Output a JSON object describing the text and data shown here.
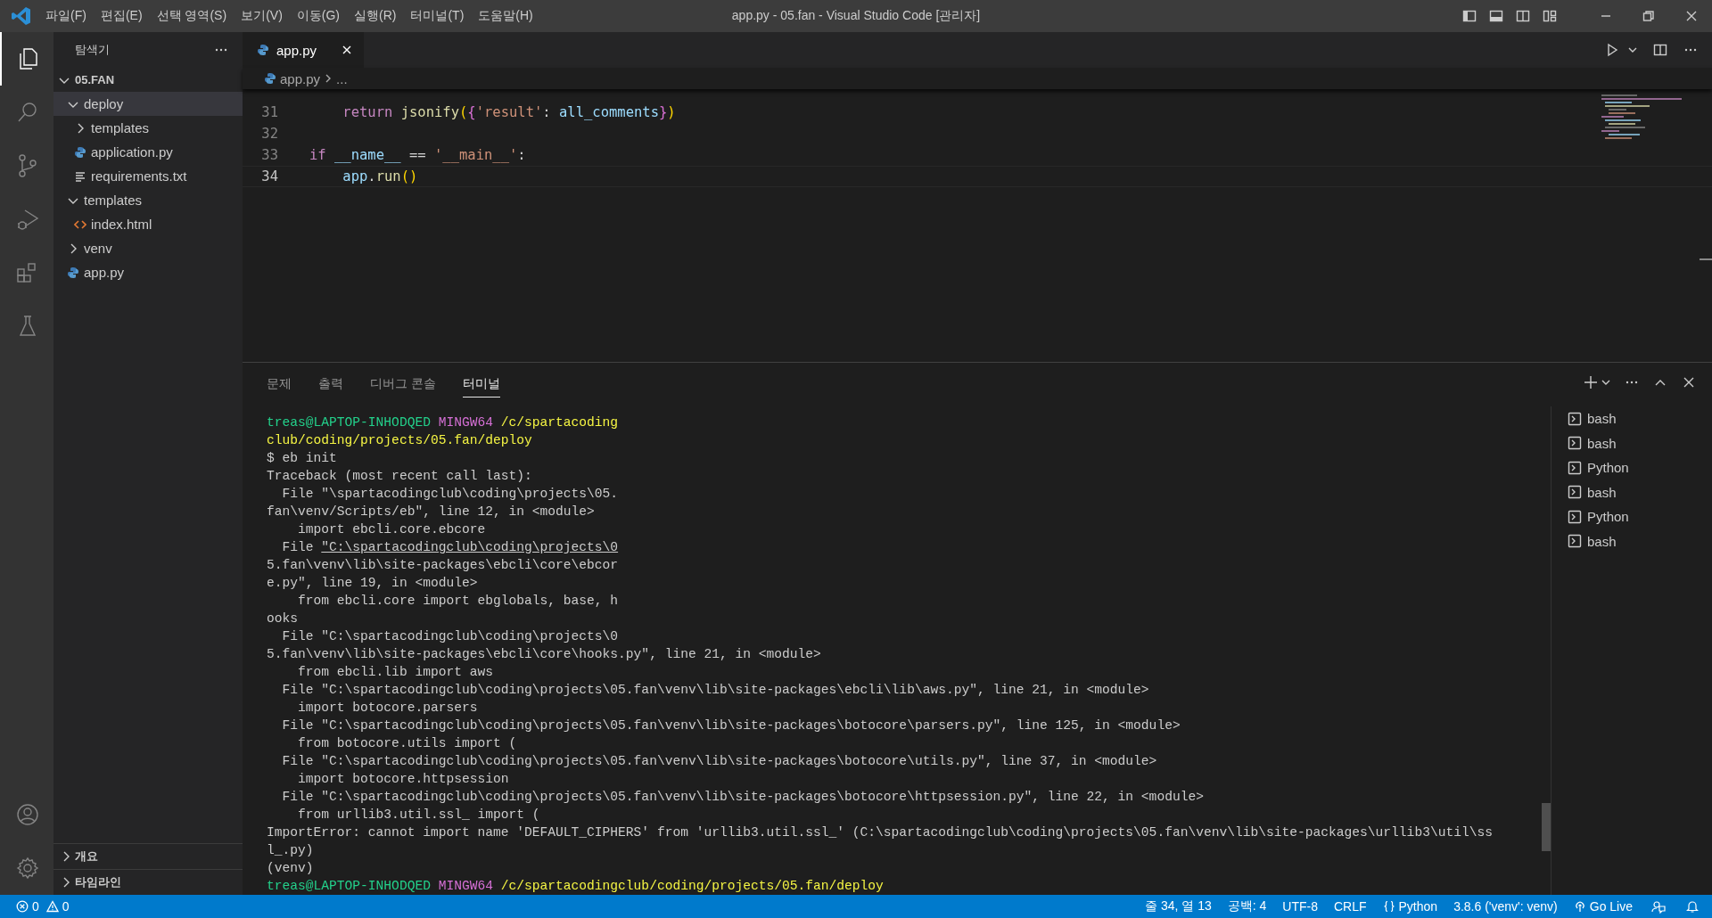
{
  "window": {
    "title": "app.py - 05.fan - Visual Studio Code [관리자]"
  },
  "menu": [
    "파일(F)",
    "편집(E)",
    "선택 영역(S)",
    "보기(V)",
    "이동(G)",
    "실행(R)",
    "터미널(T)",
    "도움말(H)"
  ],
  "activity_bar": [
    {
      "kind": "explorer",
      "selected": true
    },
    {
      "kind": "search",
      "selected": false
    },
    {
      "kind": "source-control",
      "selected": false
    },
    {
      "kind": "run-debug",
      "selected": false
    },
    {
      "kind": "extensions",
      "selected": false
    },
    {
      "kind": "testing",
      "selected": false
    }
  ],
  "activity_bar_bottom": [
    {
      "kind": "account"
    },
    {
      "kind": "settings"
    }
  ],
  "sidebar": {
    "title": "탐색기",
    "root": {
      "label": "05.FAN",
      "expanded": true
    },
    "tree": [
      {
        "label": "deploy",
        "kind": "folder",
        "expanded": true,
        "selected": true,
        "children": [
          {
            "label": "templates",
            "kind": "folder",
            "expanded": false,
            "selected": false
          },
          {
            "label": "application.py",
            "kind": "python",
            "selected": false
          },
          {
            "label": "requirements.txt",
            "kind": "text",
            "selected": false
          }
        ]
      },
      {
        "label": "templates",
        "kind": "folder",
        "expanded": true,
        "selected": false,
        "children": [
          {
            "label": "index.html",
            "kind": "html",
            "selected": false
          }
        ]
      },
      {
        "label": "venv",
        "kind": "folder",
        "expanded": false,
        "selected": false
      },
      {
        "label": "app.py",
        "kind": "python",
        "selected": false
      }
    ],
    "sections": [
      {
        "label": "개요",
        "expanded": false
      },
      {
        "label": "타임라인",
        "expanded": false
      }
    ]
  },
  "editor": {
    "tabs": [
      {
        "label": "app.py",
        "selected": true
      }
    ],
    "breadcrumb": [
      "app.py",
      "..."
    ],
    "lines": [
      {
        "number": "31",
        "current": false,
        "tokens": [
          {
            "text": "    return",
            "kind": "keyword"
          },
          {
            "text": " jsonify",
            "kind": "func"
          },
          {
            "text": "(",
            "kind": "bracket1"
          },
          {
            "text": "{",
            "kind": "bracket2"
          },
          {
            "text": "'result'",
            "kind": "string"
          },
          {
            "text": ": ",
            "kind": "plain"
          },
          {
            "text": "all_comments",
            "kind": "var"
          },
          {
            "text": "}",
            "kind": "bracket2"
          },
          {
            "text": ")",
            "kind": "bracket1"
          }
        ]
      },
      {
        "number": "32",
        "current": false
      },
      {
        "number": "33",
        "current": false,
        "tokens": [
          {
            "text": "if",
            "kind": "keyword"
          },
          {
            "text": " __name__",
            "kind": "var"
          },
          {
            "text": " == ",
            "kind": "plain"
          },
          {
            "text": "'__main__'",
            "kind": "string"
          },
          {
            "text": ":",
            "kind": "plain"
          }
        ]
      },
      {
        "number": "34",
        "current": true,
        "tokens": [
          {
            "text": "    app",
            "kind": "var"
          },
          {
            "text": ".",
            "kind": "plain"
          },
          {
            "text": "run",
            "kind": "func"
          },
          {
            "text": "()",
            "kind": "bracket1"
          }
        ]
      }
    ]
  },
  "panel": {
    "tabs": [
      {
        "label": "문제",
        "selected": false
      },
      {
        "label": "출력",
        "selected": false
      },
      {
        "label": "디버그 콘솔",
        "selected": false
      },
      {
        "label": "터미널",
        "selected": true
      }
    ],
    "terminal_lines": [
      [
        {
          "text": "treas@LAPTOP-INHODQED ",
          "kind": "user"
        },
        {
          "text": "MINGW64 ",
          "kind": "shell"
        },
        {
          "text": "/c/spartacoding",
          "kind": "path"
        }
      ],
      [
        {
          "text": "club/coding/projects/05.fan/deploy",
          "kind": "path"
        }
      ],
      [
        {
          "text": "$ eb init",
          "kind": "plain"
        }
      ],
      [
        {
          "text": "Traceback (most recent call last):",
          "kind": "plain"
        }
      ],
      [
        {
          "text": "  File \"\\spartacodingclub\\coding\\projects\\05.",
          "kind": "plain"
        }
      ],
      [
        {
          "text": "fan\\venv/Scripts/eb\", line 12, in <module>",
          "kind": "plain"
        }
      ],
      [
        {
          "text": "    import ebcli.core.ebcore",
          "kind": "plain"
        }
      ],
      [
        {
          "text": "  File ",
          "kind": "plain"
        },
        {
          "text": "\"C:\\spartacodingclub\\coding\\projects\\0",
          "kind": "link"
        }
      ],
      [
        {
          "text": "5.fan\\venv\\lib\\site-packages\\ebcli\\core\\ebcor",
          "kind": "plain"
        }
      ],
      [
        {
          "text": "e.py\", line 19, in <module>",
          "kind": "plain"
        }
      ],
      [
        {
          "text": "    from ebcli.core import ebglobals, base, h",
          "kind": "plain"
        }
      ],
      [
        {
          "text": "ooks",
          "kind": "plain"
        }
      ],
      [
        {
          "text": "  File \"C:\\spartacodingclub\\coding\\projects\\0",
          "kind": "plain"
        }
      ],
      [
        {
          "text": "5.fan\\venv\\lib\\site-packages\\ebcli\\core\\hooks.py\", line 21, in <module>",
          "kind": "plain"
        }
      ],
      [
        {
          "text": "    from ebcli.lib import aws",
          "kind": "plain"
        }
      ],
      [
        {
          "text": "  File \"C:\\spartacodingclub\\coding\\projects\\05.fan\\venv\\lib\\site-packages\\ebcli\\lib\\aws.py\", line 21, in <module>",
          "kind": "plain"
        }
      ],
      [
        {
          "text": "    import botocore.parsers",
          "kind": "plain"
        }
      ],
      [
        {
          "text": "  File \"C:\\spartacodingclub\\coding\\projects\\05.fan\\venv\\lib\\site-packages\\botocore\\parsers.py\", line 125, in <module>",
          "kind": "plain"
        }
      ],
      [
        {
          "text": "    from botocore.utils import (",
          "kind": "plain"
        }
      ],
      [
        {
          "text": "  File \"C:\\spartacodingclub\\coding\\projects\\05.fan\\venv\\lib\\site-packages\\botocore\\utils.py\", line 37, in <module>",
          "kind": "plain"
        }
      ],
      [
        {
          "text": "    import botocore.httpsession",
          "kind": "plain"
        }
      ],
      [
        {
          "text": "  File \"C:\\spartacodingclub\\coding\\projects\\05.fan\\venv\\lib\\site-packages\\botocore\\httpsession.py\", line 22, in <module>",
          "kind": "plain"
        }
      ],
      [
        {
          "text": "    from urllib3.util.ssl_ import (",
          "kind": "plain"
        }
      ],
      [
        {
          "text": "ImportError: cannot import name 'DEFAULT_CIPHERS' from 'urllib3.util.ssl_' (C:\\spartacodingclub\\coding\\projects\\05.fan\\venv\\lib\\site-packages\\urllib3\\util\\ss",
          "kind": "plain"
        }
      ],
      [
        {
          "text": "l_.py)",
          "kind": "plain"
        }
      ],
      [
        {
          "text": "(venv)",
          "kind": "plain"
        }
      ],
      [
        {
          "text": "treas@LAPTOP-INHODQED ",
          "kind": "user"
        },
        {
          "text": "MINGW64 ",
          "kind": "shell"
        },
        {
          "text": "/c/spartacodingclub/coding/projects/05.fan/deploy",
          "kind": "path"
        }
      ]
    ],
    "terminals": [
      "bash",
      "bash",
      "Python",
      "bash",
      "Python",
      "bash"
    ]
  },
  "status_bar": {
    "errors": "0",
    "warnings": "0",
    "items": [
      "줄 34, 열 13",
      "공백: 4",
      "UTF-8",
      "CRLF"
    ],
    "language": "Python",
    "interpreter": "3.8.6 ('venv': venv)",
    "live": "Go Live"
  }
}
